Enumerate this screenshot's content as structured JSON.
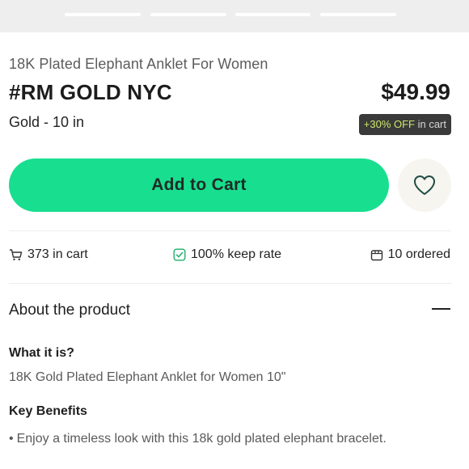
{
  "product": {
    "subtitle": "18K Plated Elephant Anklet For Women",
    "brand": "#RM GOLD NYC",
    "price": "$49.99",
    "variant": "Gold - 10 in",
    "discount": {
      "highlight": "+30% OFF",
      "suffix": " in cart"
    }
  },
  "actions": {
    "add_to_cart": "Add to Cart",
    "wishlist_icon": "heart-icon"
  },
  "stats": [
    {
      "icon": "cart-icon",
      "label": "373 in cart"
    },
    {
      "icon": "check-square-icon",
      "label": "100% keep rate"
    },
    {
      "icon": "box-icon",
      "label": "10 ordered"
    }
  ],
  "about": {
    "title": "About the product",
    "what_heading": "What it is?",
    "what_text": "18K Gold Plated Elephant Anklet for Women 10\"",
    "key_heading": "Key Benefits",
    "bullets": [
      "Enjoy a timeless look with this 18k gold plated elephant bracelet."
    ]
  },
  "colors": {
    "accent": "#18df8f",
    "discount_bg": "#3a3a3a",
    "discount_highlight": "#c9e86b"
  }
}
